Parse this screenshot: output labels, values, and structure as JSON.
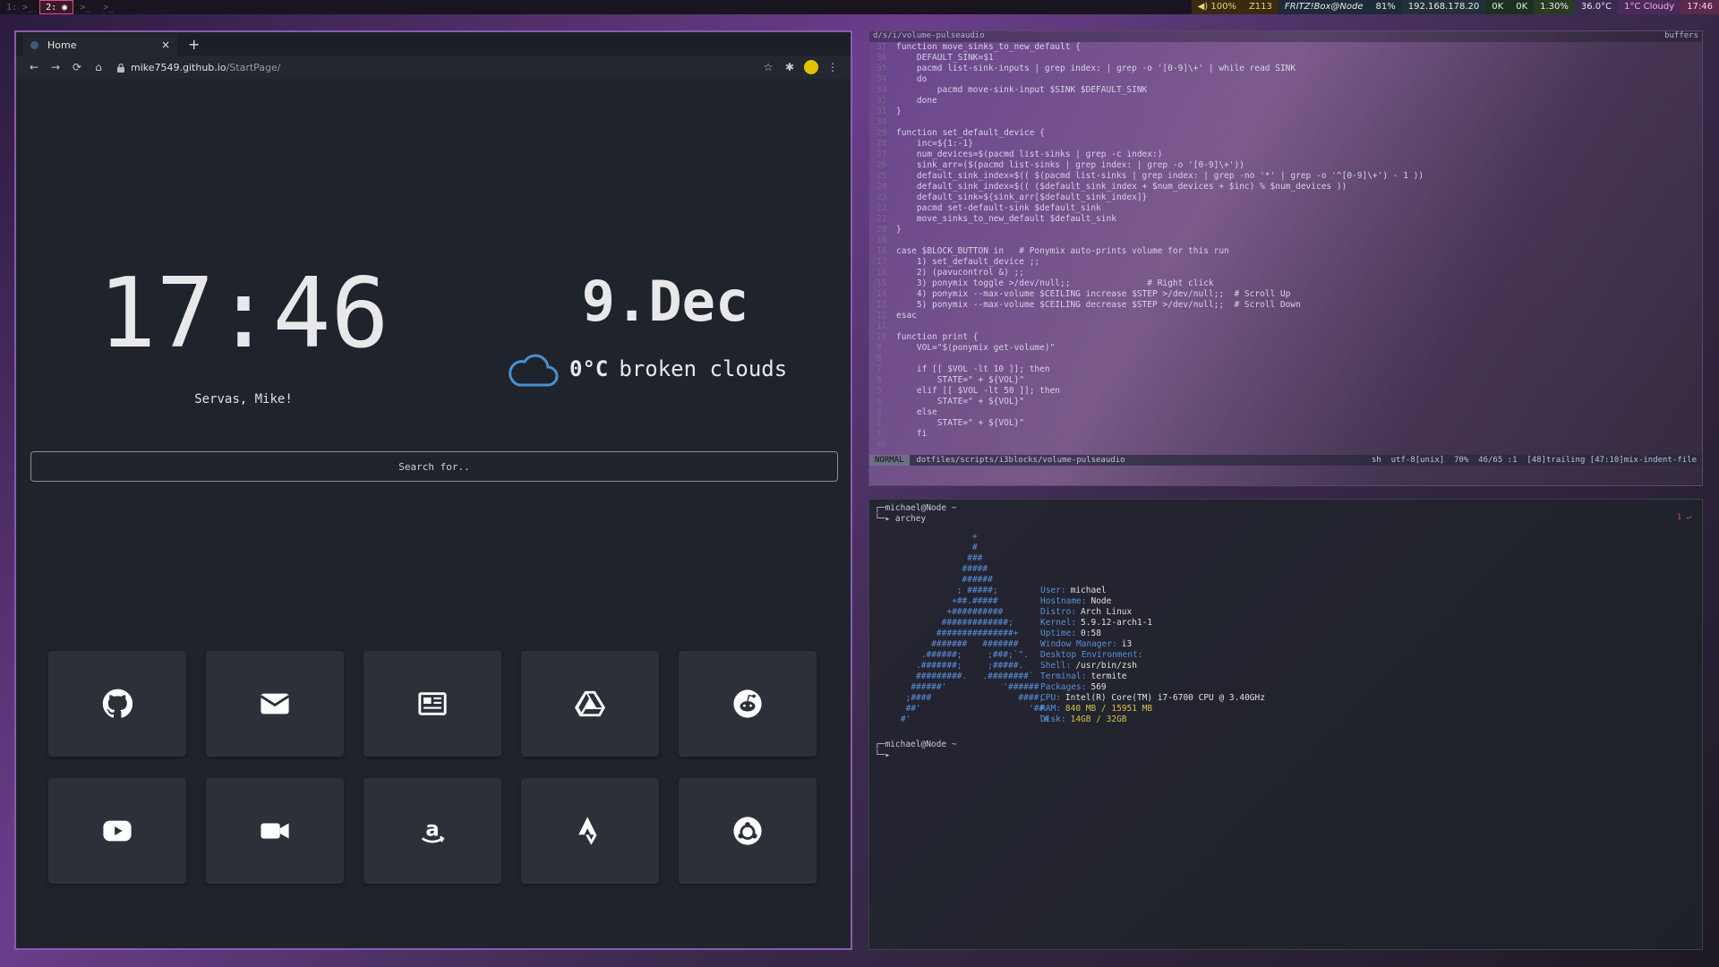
{
  "topbar": {
    "workspaces": [
      "1: >_",
      "2: ◉",
      ">_",
      ">_"
    ],
    "status": [
      "◀) 100%",
      "Z113",
      "FRITZ!Box@Node",
      "81%",
      "192.168.178.20",
      "0K",
      "0K",
      "1.30%",
      "36.0°C",
      "1°C Cloudy",
      "17:46"
    ]
  },
  "browser": {
    "tab_title": "Home",
    "tab_close": "×",
    "new_tab": "+",
    "url_host": "mike7549.github.io",
    "url_path": "/StartPage/",
    "nav": {
      "back": "←",
      "forward": "→",
      "reload": "⟳",
      "home": "⌂",
      "star": "☆",
      "extensions": "✱",
      "menu": "⋮"
    }
  },
  "startpage": {
    "clock": "17:46",
    "greeting": "Servas, Mike!",
    "date": "9.Dec",
    "weather_temp": "0°C",
    "weather_desc": "broken clouds",
    "search_placeholder": "Search for..",
    "shortcuts": [
      {
        "name": "github",
        "icon": "github-icon"
      },
      {
        "name": "mail",
        "icon": "envelope-icon"
      },
      {
        "name": "news",
        "icon": "newspaper-icon"
      },
      {
        "name": "drive",
        "icon": "google-drive-icon"
      },
      {
        "name": "reddit",
        "icon": "reddit-icon"
      },
      {
        "name": "youtube",
        "icon": "youtube-icon"
      },
      {
        "name": "video",
        "icon": "video-camera-icon"
      },
      {
        "name": "amazon",
        "icon": "amazon-icon"
      },
      {
        "name": "strava",
        "icon": "strava-icon"
      },
      {
        "name": "ubuntu",
        "icon": "ubuntu-icon"
      }
    ]
  },
  "editor": {
    "title_path": "d/s/i/volume-pulseaudio",
    "buffers_label": "buffers",
    "lines": [
      {
        "n": "37",
        "t": "function move_sinks_to_new_default {"
      },
      {
        "n": "36",
        "t": "    DEFAULT_SINK=$1"
      },
      {
        "n": "35",
        "t": "    pacmd list-sink-inputs | grep index: | grep -o '[0-9]\\+' | while read SINK"
      },
      {
        "n": "34",
        "t": "    do"
      },
      {
        "n": "33",
        "t": "        pacmd move-sink-input $SINK $DEFAULT_SINK"
      },
      {
        "n": "32",
        "t": "    done"
      },
      {
        "n": "31",
        "t": "}"
      },
      {
        "n": "30",
        "t": ""
      },
      {
        "n": "29",
        "t": "function set_default_device {"
      },
      {
        "n": "28",
        "t": "    inc=${1:-1}"
      },
      {
        "n": "27",
        "t": "    num_devices=$(pacmd list-sinks | grep -c index:)"
      },
      {
        "n": "26",
        "t": "    sink_arr=($(pacmd list-sinks | grep index: | grep -o '[0-9]\\+'))"
      },
      {
        "n": "25",
        "t": "    default_sink_index=$(( $(pacmd list-sinks | grep index: | grep -no '*' | grep -o '^[0-9]\\+') - 1 ))"
      },
      {
        "n": "24",
        "t": "    default_sink_index=$(( ($default_sink_index + $num_devices + $inc) % $num_devices ))"
      },
      {
        "n": "23",
        "t": "    default_sink=${sink_arr[$default_sink_index]}"
      },
      {
        "n": "22",
        "t": "    pacmd set-default-sink $default_sink"
      },
      {
        "n": "21",
        "t": "    move_sinks_to_new_default $default_sink"
      },
      {
        "n": "20",
        "t": "}"
      },
      {
        "n": "19",
        "t": ""
      },
      {
        "n": "18",
        "t": "case $BLOCK_BUTTON in   # Ponymix auto-prints volume for this run"
      },
      {
        "n": "17",
        "t": "    1) set_default_device ;;"
      },
      {
        "n": "16",
        "t": "    2) (pavucontrol &) ;;"
      },
      {
        "n": "15",
        "t": "    3) ponymix toggle >/dev/null;;               # Right click"
      },
      {
        "n": "14",
        "t": "    4) ponymix --max-volume $CEILING increase $STEP >/dev/null;;  # Scroll Up"
      },
      {
        "n": "13",
        "t": "    5) ponymix --max-volume $CEILING decrease $STEP >/dev/null;;  # Scroll Down"
      },
      {
        "n": "12",
        "t": "esac"
      },
      {
        "n": "11",
        "t": ""
      },
      {
        "n": "10",
        "t": "function print {"
      },
      {
        "n": "9",
        "t": "    VOL=\"$(ponymix get-volume)\""
      },
      {
        "n": "8",
        "t": ""
      },
      {
        "n": "7",
        "t": "    if [[ $VOL -lt 10 ]]; then"
      },
      {
        "n": "6",
        "t": "        STATE=\" + ${VOL}\""
      },
      {
        "n": "5",
        "t": "    elif [[ $VOL -lt 50 ]]; then"
      },
      {
        "n": "4",
        "t": "        STATE=\" + ${VOL}\""
      },
      {
        "n": "3",
        "t": "    else"
      },
      {
        "n": "2",
        "t": "        STATE=\" + ${VOL}\""
      },
      {
        "n": "1",
        "t": "    fi"
      },
      {
        "n": "46",
        "t": ""
      }
    ],
    "status_mode": "NORMAL",
    "status_file": "dotfiles/scripts/i3blocks/volume-pulseaudio",
    "status_right": "sh  utf-8[unix]  70%  46/65 :1  [48]trailing [47:10]mix-indent-file"
  },
  "terminal": {
    "prompt1_user": "michael@Node ~",
    "prompt1_cmd": "archey",
    "return_code": "1 ↵",
    "ascii_art": "                  +\n                  #\n                 ###\n                #####\n                ######\n               ; #####;\n              +##.#####\n             +##########\n            #############;\n           ###############+\n          #######   #######\n        .######;     ;###;`\".\n       .#######;     ;#####.\n       #########.   .########`\n      ######'           '######\n     ;####                 ####;\n     ##'                     '##\n    #'                         `#",
    "info": [
      {
        "k": "User:",
        "v": "michael"
      },
      {
        "k": "Hostname:",
        "v": "Node"
      },
      {
        "k": "Distro:",
        "v": "Arch Linux"
      },
      {
        "k": "Kernel:",
        "v": "5.9.12-arch1-1"
      },
      {
        "k": "Uptime:",
        "v": "0:58"
      },
      {
        "k": "Window Manager:",
        "v": "i3"
      },
      {
        "k": "Desktop Environment:",
        "v": ""
      },
      {
        "k": "Shell:",
        "v": "/usr/bin/zsh"
      },
      {
        "k": "Terminal:",
        "v": "termite"
      },
      {
        "k": "Packages:",
        "v": "569"
      },
      {
        "k": "CPU:",
        "v": "Intel(R) Core(TM) i7-6700 CPU @ 3.40GHz"
      },
      {
        "k": "RAM:",
        "v": "840 MB / 15951 MB"
      },
      {
        "k": "Disk:",
        "v": "14GB / 32GB"
      }
    ],
    "prompt2_user": "michael@Node ~"
  }
}
